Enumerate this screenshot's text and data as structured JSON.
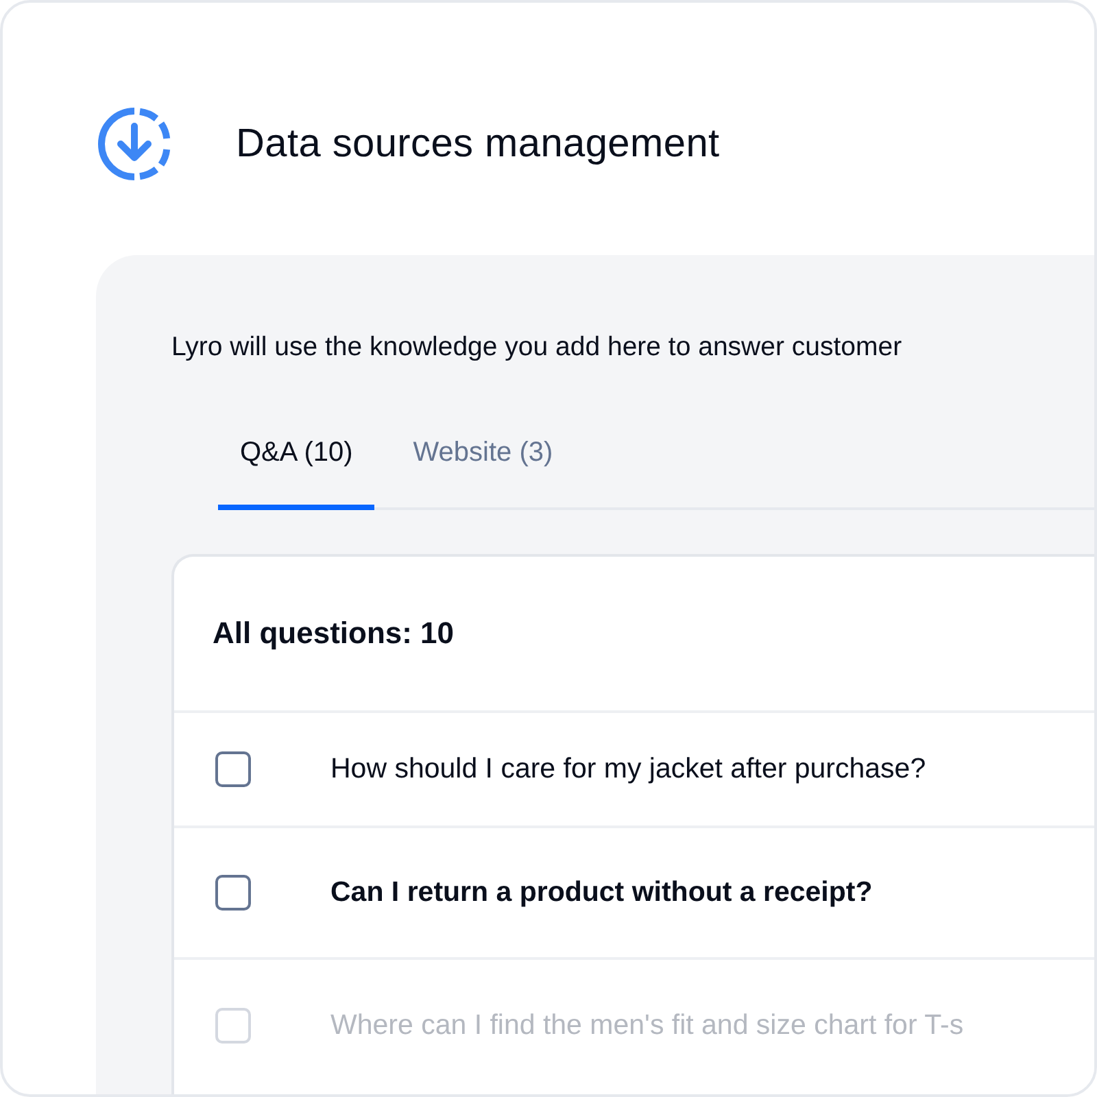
{
  "header": {
    "title": "Data sources management"
  },
  "description": "Lyro will use the knowledge you add here to answer customer",
  "tabs": [
    {
      "label": "Q&A (10)",
      "selected": true
    },
    {
      "label": "Website (3)",
      "selected": false
    }
  ],
  "list": {
    "heading": "All questions: 10",
    "rows": [
      {
        "text": "How should I care for my jacket after purchase?",
        "checked": false,
        "bold": false,
        "faded": false
      },
      {
        "text": "Can I return a product without a receipt?",
        "checked": false,
        "bold": true,
        "faded": false
      },
      {
        "text": "Where can I find the men's fit and size chart for T-s",
        "checked": false,
        "bold": false,
        "faded": true
      }
    ]
  }
}
